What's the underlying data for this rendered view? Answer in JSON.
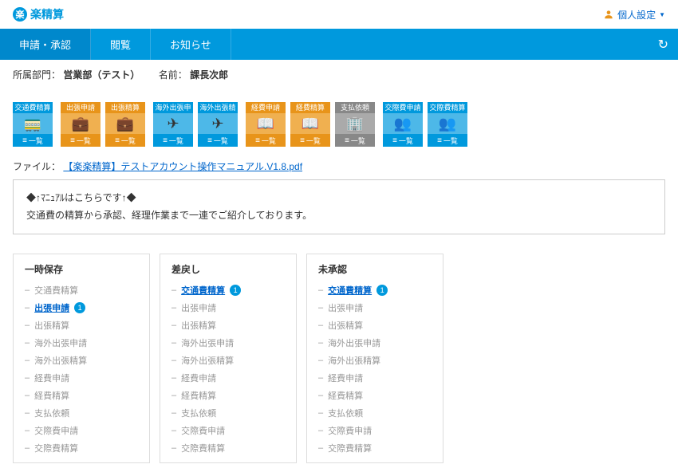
{
  "header": {
    "logo_text": "楽精算",
    "logo_badge": "楽",
    "user_settings": "個人設定"
  },
  "nav": {
    "tabs": [
      "申請・承認",
      "閲覧",
      "お知らせ"
    ]
  },
  "info": {
    "dept_label": "所属部門：",
    "dept_value": "営業部（テスト）",
    "name_label": "名前：",
    "name_value": "課長次郎"
  },
  "icon_cards": {
    "group1": [
      {
        "title": "交通費精算",
        "footer": "一覧",
        "color": "blue",
        "icon": "🚃"
      }
    ],
    "group2": [
      {
        "title": "出張申請",
        "footer": "一覧",
        "color": "orange",
        "icon": "💼"
      },
      {
        "title": "出張精算",
        "footer": "一覧",
        "color": "orange",
        "icon": "💼"
      }
    ],
    "group3": [
      {
        "title": "海外出張申請",
        "footer": "一覧",
        "color": "blue",
        "icon": "✈"
      },
      {
        "title": "海外出張精算",
        "footer": "一覧",
        "color": "blue",
        "icon": "✈"
      }
    ],
    "group4": [
      {
        "title": "経費申請",
        "footer": "一覧",
        "color": "orange",
        "icon": "📖"
      },
      {
        "title": "経費精算",
        "footer": "一覧",
        "color": "orange",
        "icon": "📖"
      },
      {
        "title": "支払依頼",
        "footer": "一覧",
        "color": "gray",
        "icon": "🏢"
      }
    ],
    "group5": [
      {
        "title": "交際費申請",
        "footer": "一覧",
        "color": "blue",
        "icon": "👥"
      },
      {
        "title": "交際費精算",
        "footer": "一覧",
        "color": "blue",
        "icon": "👥"
      }
    ]
  },
  "file": {
    "label": "ファイル：",
    "link": "【楽楽精算】テストアカウント操作マニュアル.V1.8.pdf"
  },
  "notice": {
    "line1": "◆↑ﾏﾆｭｱﾙはこちらです↑◆",
    "line2": "交通費の精算から承認、経理作業まで一連でご紹介しております。"
  },
  "status": {
    "columns": [
      {
        "title": "一時保存",
        "items": [
          {
            "text": "交通費精算",
            "active": false
          },
          {
            "text": "出張申請",
            "active": true,
            "badge": "1"
          },
          {
            "text": "出張精算",
            "active": false
          },
          {
            "text": "海外出張申請",
            "active": false
          },
          {
            "text": "海外出張精算",
            "active": false
          },
          {
            "text": "経費申請",
            "active": false
          },
          {
            "text": "経費精算",
            "active": false
          },
          {
            "text": "支払依頼",
            "active": false
          },
          {
            "text": "交際費申請",
            "active": false
          },
          {
            "text": "交際費精算",
            "active": false
          }
        ]
      },
      {
        "title": "差戻し",
        "items": [
          {
            "text": "交通費精算",
            "active": true,
            "badge": "1"
          },
          {
            "text": "出張申請",
            "active": false
          },
          {
            "text": "出張精算",
            "active": false
          },
          {
            "text": "海外出張申請",
            "active": false
          },
          {
            "text": "海外出張精算",
            "active": false
          },
          {
            "text": "経費申請",
            "active": false
          },
          {
            "text": "経費精算",
            "active": false
          },
          {
            "text": "支払依頼",
            "active": false
          },
          {
            "text": "交際費申請",
            "active": false
          },
          {
            "text": "交際費精算",
            "active": false
          }
        ]
      },
      {
        "title": "未承認",
        "items": [
          {
            "text": "交通費精算",
            "active": true,
            "badge": "1"
          },
          {
            "text": "出張申請",
            "active": false
          },
          {
            "text": "出張精算",
            "active": false
          },
          {
            "text": "海外出張申請",
            "active": false
          },
          {
            "text": "海外出張精算",
            "active": false
          },
          {
            "text": "経費申請",
            "active": false
          },
          {
            "text": "経費精算",
            "active": false
          },
          {
            "text": "支払依頼",
            "active": false
          },
          {
            "text": "交際費申請",
            "active": false
          },
          {
            "text": "交際費精算",
            "active": false
          }
        ]
      }
    ]
  }
}
